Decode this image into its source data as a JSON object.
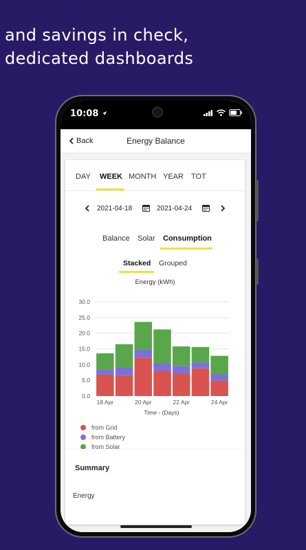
{
  "headline": {
    "line1": "and savings in check,",
    "line2": "dedicated dashboards"
  },
  "statusbar": {
    "time": "10:08",
    "icons": [
      "location-arrow-icon",
      "signal-icon",
      "wifi-icon",
      "battery-icon"
    ]
  },
  "navbar": {
    "back_label": "Back",
    "title": "Energy Balance"
  },
  "period_tabs": [
    {
      "label": "DAY",
      "active": false
    },
    {
      "label": "WEEK",
      "active": true
    },
    {
      "label": "MONTH",
      "active": false
    },
    {
      "label": "YEAR",
      "active": false
    },
    {
      "label": "TOT",
      "active": false
    }
  ],
  "date_range": {
    "start": "2021-04-18",
    "end": "2021-04-24"
  },
  "view_tabs": [
    {
      "label": "Balance",
      "active": false
    },
    {
      "label": "Solar",
      "active": false
    },
    {
      "label": "Consumption",
      "active": true
    }
  ],
  "modes": [
    {
      "label": "Stacked",
      "active": true
    },
    {
      "label": "Grouped",
      "active": false
    }
  ],
  "colors": {
    "accent": "#f0e040",
    "grid": "#d9534f",
    "battery": "#7b72d6",
    "solar": "#5aa64a",
    "background": "#291a66"
  },
  "chart_data": {
    "type": "bar",
    "stacked": true,
    "title": "Energy (kWh)",
    "xlabel": "Time - (Days)",
    "ylabel": "",
    "ylim": [
      0,
      30
    ],
    "yticks": [
      "0.0",
      "5.0",
      "10.0",
      "15.0",
      "20.0",
      "25.0",
      "30.0"
    ],
    "categories": [
      "18 Apr",
      "19 Apr",
      "20 Apr",
      "21 Apr",
      "22 Apr",
      "23 Apr",
      "24 Apr"
    ],
    "xtick_labels": [
      "18 Apr",
      "20 Apr",
      "22 Apr",
      "24 Apr"
    ],
    "series": [
      {
        "name": "from Grid",
        "color": "#d9534f",
        "values": [
          6.8,
          6.5,
          12.2,
          8.0,
          7.0,
          8.8,
          4.9
        ]
      },
      {
        "name": "from Battery",
        "color": "#7b72d6",
        "values": [
          1.7,
          2.7,
          2.6,
          2.5,
          2.6,
          1.9,
          2.0
        ]
      },
      {
        "name": "from Solar",
        "color": "#5aa64a",
        "values": [
          5.1,
          7.3,
          8.8,
          10.7,
          6.2,
          4.9,
          5.9
        ]
      }
    ],
    "legend_position": "bottom-left",
    "grid": "horizontal"
  },
  "summary": {
    "title": "Summary",
    "energy_label": "Energy"
  }
}
